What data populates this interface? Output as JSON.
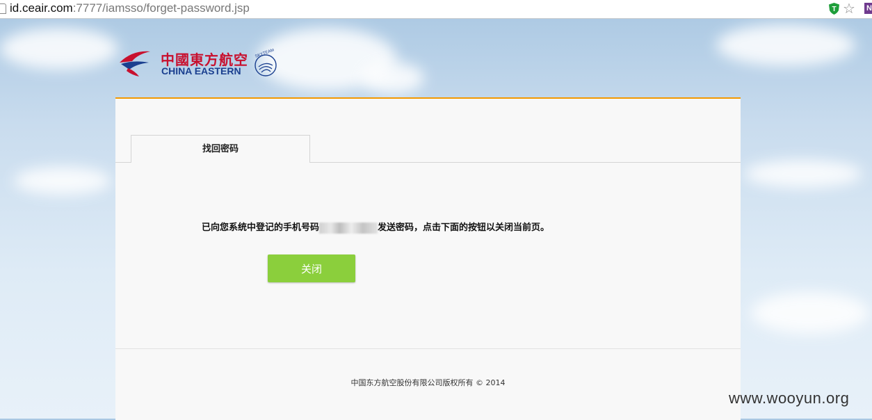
{
  "browser": {
    "url_host": "id.ceair.com",
    "url_rest": ":7777/iamsso/forget-password.jsp",
    "extension_label": "N"
  },
  "logo": {
    "name_cn": "中國東方航空",
    "name_en": "CHINA EASTERN",
    "alliance": "SKYTEAM"
  },
  "tabs": [
    {
      "label": "找回密码",
      "active": true
    }
  ],
  "message": {
    "before": "已向您系统中登记的手机号码",
    "after": "发送密码，点击下面的按钮以关闭当前页。"
  },
  "close_button": {
    "label": "关闭"
  },
  "footer": {
    "copyright": "中国东方航空股份有限公司版权所有 © 2014"
  },
  "watermark": "www.wooyun.org",
  "colors": {
    "accent_orange": "#f39800",
    "button_green": "#8bcf3c",
    "brand_red": "#c8102e",
    "brand_blue": "#1a3f8f"
  }
}
